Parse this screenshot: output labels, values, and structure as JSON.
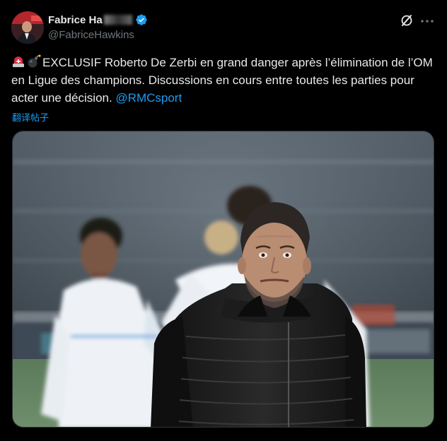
{
  "author": {
    "display_name": "Fabrice Ha",
    "handle": "@FabriceHawkins",
    "verified": true
  },
  "tweet": {
    "text_prefix": "EXCLUSIF Roberto De Zerbi en grand danger après l’élimination de l’OM en Ligue des champions. Discussions en cours entre toutes les parties pour acter une décision. ",
    "mention": "@RMCsport",
    "emojis": [
      "rotating-light-icon",
      "bomb-icon"
    ]
  },
  "translate_label": "翻译帖子",
  "icons": {
    "grok": "grok-icon",
    "more": "more-icon"
  },
  "colors": {
    "background": "#000000",
    "text": "#e7e9ea",
    "secondary": "#71767b",
    "accent": "#1d9bf0"
  },
  "media": {
    "type": "photo",
    "subject": "coach-photo"
  }
}
